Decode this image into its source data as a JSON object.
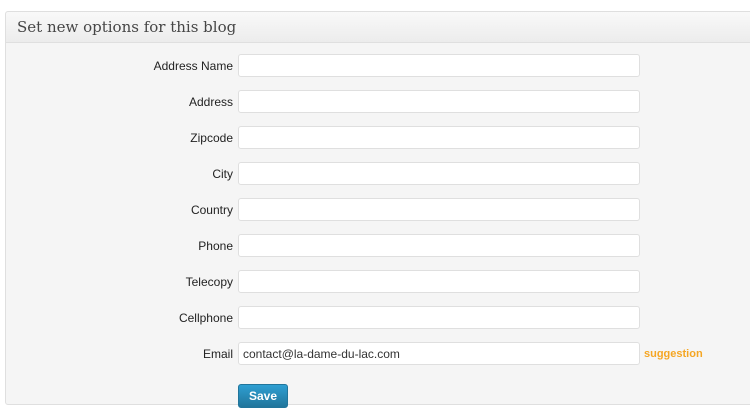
{
  "panel": {
    "title": "Set new options for this blog"
  },
  "fields": [
    {
      "label": "Address Name",
      "value": ""
    },
    {
      "label": "Address",
      "value": ""
    },
    {
      "label": "Zipcode",
      "value": ""
    },
    {
      "label": "City",
      "value": ""
    },
    {
      "label": "Country",
      "value": ""
    },
    {
      "label": "Phone",
      "value": ""
    },
    {
      "label": "Telecopy",
      "value": ""
    },
    {
      "label": "Cellphone",
      "value": ""
    },
    {
      "label": "Email",
      "value": "contact@la-dame-du-lac.com"
    }
  ],
  "email_suggestion": "suggestion",
  "save_label": "Save",
  "colors": {
    "accent": "#21759b",
    "suggestion": "#f5a623"
  }
}
